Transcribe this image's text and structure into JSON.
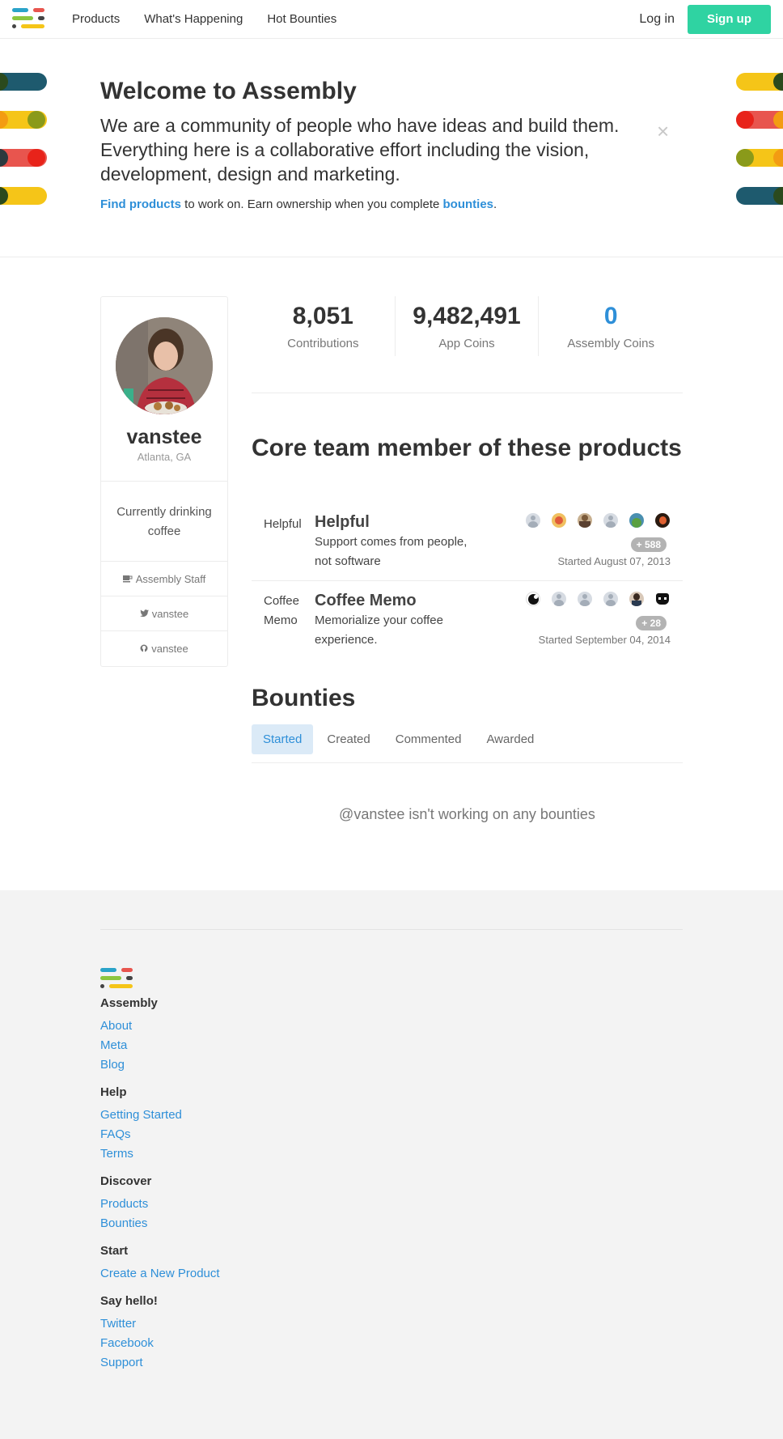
{
  "nav": {
    "links": [
      "Products",
      "What's Happening",
      "Hot Bounties"
    ],
    "login": "Log in",
    "signup": "Sign up"
  },
  "welcome": {
    "title": "Welcome to Assembly",
    "lead": "We are a community of people who have ideas and build them. Everything here is a collaborative effort including the vision, development, design and marketing.",
    "find_link": "Find products",
    "middle_text": " to work on. Earn ownership when you complete ",
    "bounties_link": "bounties",
    "end_text": ".",
    "close": "×"
  },
  "profile": {
    "username": "vanstee",
    "location": "Atlanta, GA",
    "bio": "Currently drinking coffee",
    "staff": "Assembly Staff",
    "twitter": "vanstee",
    "github": "vanstee"
  },
  "stats": [
    {
      "value": "8,051",
      "label": "Contributions"
    },
    {
      "value": "9,482,491",
      "label": "App Coins"
    },
    {
      "value": "0",
      "label": "Assembly Coins"
    }
  ],
  "core_title": "Core team member of these products",
  "products": [
    {
      "short": "Helpful",
      "name": "Helpful",
      "desc": "Support comes from people, not software",
      "more": "+ 588",
      "started": "Started August 07, 2013"
    },
    {
      "short": "Coffee Memo",
      "name": "Coffee Memo",
      "desc": "Memorialize your coffee experience.",
      "more": "+ 28",
      "started": "Started September 04, 2014"
    }
  ],
  "bounties": {
    "title": "Bounties",
    "tabs": [
      "Started",
      "Created",
      "Commented",
      "Awarded"
    ],
    "empty": "@vanstee isn't working on any bounties"
  },
  "footer": {
    "brand": "Assembly",
    "brand_links": [
      "About",
      "Meta",
      "Blog"
    ],
    "help_title": "Help",
    "help_links": [
      "Getting Started",
      "FAQs",
      "Terms"
    ],
    "discover_title": "Discover",
    "discover_links": [
      "Products",
      "Bounties"
    ],
    "start_title": "Start",
    "start_links": [
      "Create a New Product"
    ],
    "hello_title": "Say hello!",
    "hello_links": [
      "Twitter",
      "Facebook",
      "Support"
    ]
  },
  "colors": {
    "accent": "#2e8fd8",
    "signup": "#2fd3a2",
    "footer_bg": "#f3f3f3"
  }
}
